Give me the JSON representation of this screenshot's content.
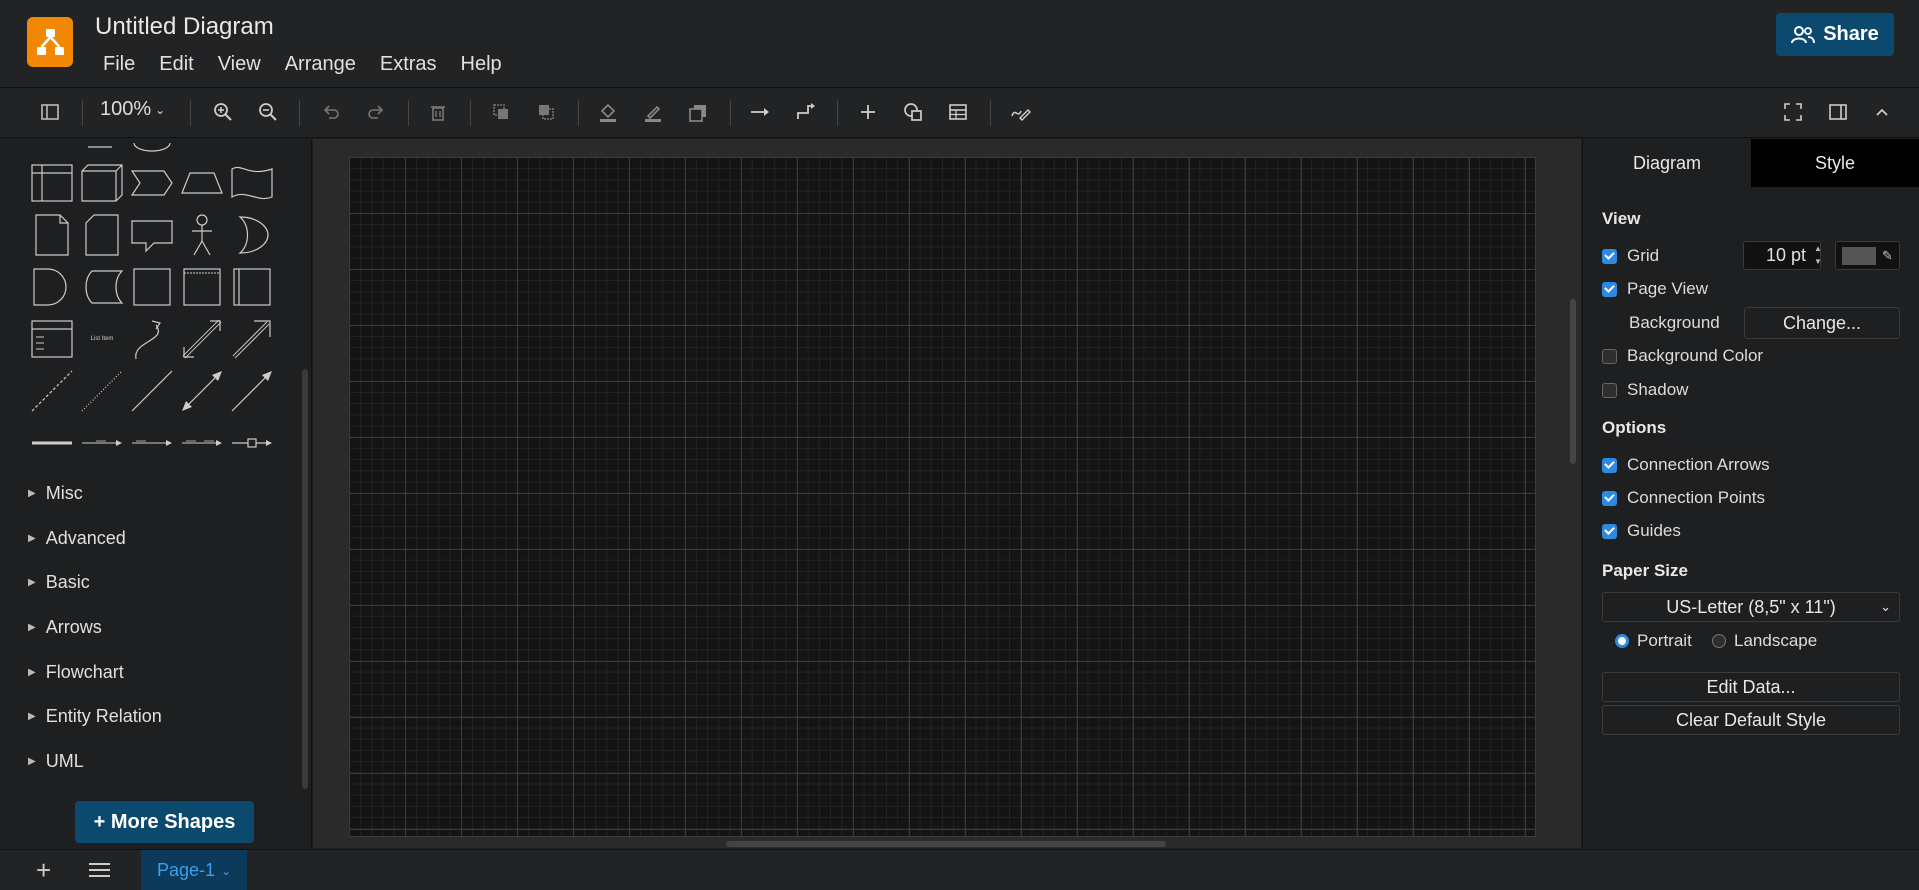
{
  "app": {
    "title": "Untitled Diagram",
    "share_label": "Share",
    "accent_color": "#0b4a6e",
    "logo_color": "#f08705"
  },
  "menu": [
    "File",
    "Edit",
    "View",
    "Arrange",
    "Extras",
    "Help"
  ],
  "toolbar": {
    "zoom": "100%",
    "icons": [
      "sidebar-toggle-icon",
      "zoom-in-icon",
      "zoom-out-icon",
      "undo-icon",
      "redo-icon",
      "delete-icon",
      "to-front-icon",
      "to-back-icon",
      "fill-color-icon",
      "line-color-icon",
      "shadow-icon",
      "connection-icon",
      "waypoints-icon",
      "insert-icon",
      "shapes-icon",
      "table-icon",
      "freehand-icon",
      "fullscreen-icon",
      "format-panel-icon",
      "collapse-icon"
    ]
  },
  "sidebar": {
    "palettes": [
      "Misc",
      "Advanced",
      "Basic",
      "Arrows",
      "Flowchart",
      "Entity Relation",
      "UML"
    ],
    "more_shapes_label": "+ More Shapes",
    "list_item_label": "List Item"
  },
  "panel": {
    "tabs": [
      "Diagram",
      "Style"
    ],
    "view_heading": "View",
    "grid_label": "Grid",
    "grid_checked": true,
    "grid_size": "10 pt",
    "page_view_label": "Page View",
    "page_view_checked": true,
    "background_label": "Background",
    "change_label": "Change...",
    "background_color_label": "Background Color",
    "background_color_checked": false,
    "shadow_label": "Shadow",
    "shadow_checked": false,
    "options_heading": "Options",
    "connection_arrows_label": "Connection Arrows",
    "connection_points_label": "Connection Points",
    "guides_label": "Guides",
    "paper_size_heading": "Paper Size",
    "paper_size": "US-Letter (8,5\" x 11\")",
    "portrait_label": "Portrait",
    "landscape_label": "Landscape",
    "orientation": "Portrait",
    "edit_data_label": "Edit Data...",
    "clear_style_label": "Clear Default Style"
  },
  "bottom": {
    "page_tab": "Page-1"
  }
}
